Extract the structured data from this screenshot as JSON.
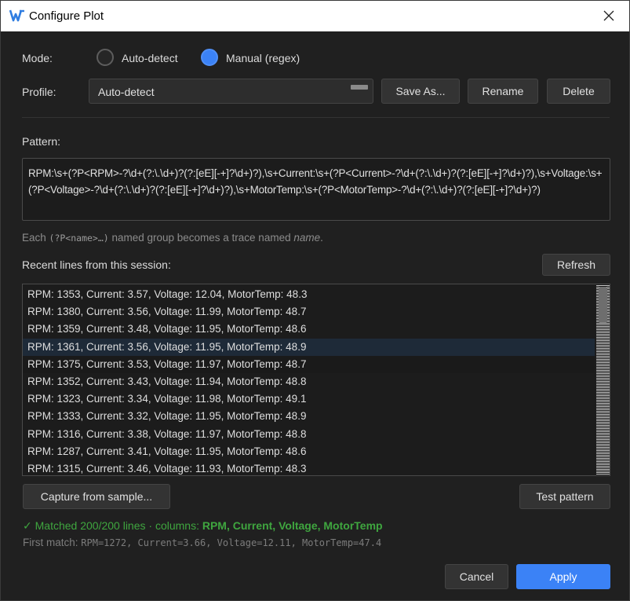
{
  "window": {
    "title": "Configure Plot"
  },
  "mode": {
    "label": "Mode:",
    "options": [
      {
        "label": "Auto-detect",
        "selected": false
      },
      {
        "label": "Manual (regex)",
        "selected": true
      }
    ]
  },
  "profile": {
    "label": "Profile:",
    "value": "Auto-detect",
    "save_as": "Save As...",
    "rename": "Rename",
    "delete": "Delete"
  },
  "pattern": {
    "label": "Pattern:",
    "value": "RPM:\\s+(?P<RPM>-?\\d+(?:\\.\\d+)?(?:[eE][-+]?\\d+)?),\\s+Current:\\s+(?P<Current>-?\\d+(?:\\.\\d+)?(?:[eE][-+]?\\d+)?),\\s+Voltage:\\s+(?P<Voltage>-?\\d+(?:\\.\\d+)?(?:[eE][-+]?\\d+)?),\\s+MotorTemp:\\s+(?P<MotorTemp>-?\\d+(?:\\.\\d+)?(?:[eE][-+]?\\d+)?)"
  },
  "help": {
    "prefix": "Each ",
    "code": "(?P<name>…)",
    "middle": " named group becomes a trace named ",
    "em": "name",
    "suffix": "."
  },
  "recent": {
    "label": "Recent lines from this session:",
    "refresh": "Refresh",
    "selected_index": 3,
    "lines": [
      "RPM: 1353, Current: 3.57, Voltage: 12.04, MotorTemp: 48.3",
      "RPM: 1380, Current: 3.56, Voltage: 11.99, MotorTemp: 48.7",
      "RPM: 1359, Current: 3.48, Voltage: 11.95, MotorTemp: 48.6",
      "RPM: 1361, Current: 3.56, Voltage: 11.95, MotorTemp: 48.9",
      "RPM: 1375, Current: 3.53, Voltage: 11.97, MotorTemp: 48.7",
      "RPM: 1352, Current: 3.43, Voltage: 11.94, MotorTemp: 48.8",
      "RPM: 1323, Current: 3.34, Voltage: 11.98, MotorTemp: 49.1",
      "RPM: 1333, Current: 3.32, Voltage: 11.95, MotorTemp: 48.9",
      "RPM: 1316, Current: 3.38, Voltage: 11.97, MotorTemp: 48.8",
      "RPM: 1287, Current: 3.41, Voltage: 11.95, MotorTemp: 48.6",
      "RPM: 1315, Current: 3.46, Voltage: 11.93, MotorTemp: 48.3"
    ]
  },
  "actions": {
    "capture": "Capture from sample...",
    "test": "Test pattern",
    "cancel": "Cancel",
    "apply": "Apply"
  },
  "status": {
    "check": "✓",
    "text": " Matched 200/200 lines · columns: ",
    "columns": "RPM, Current, Voltage, MotorTemp"
  },
  "first_match": {
    "label": "First match: ",
    "value": "RPM=1272, Current=3.66, Voltage=12.11, MotorTemp=47.4"
  },
  "colors": {
    "accent": "#3b82f6",
    "success": "#3fa63f",
    "background": "#202020"
  }
}
